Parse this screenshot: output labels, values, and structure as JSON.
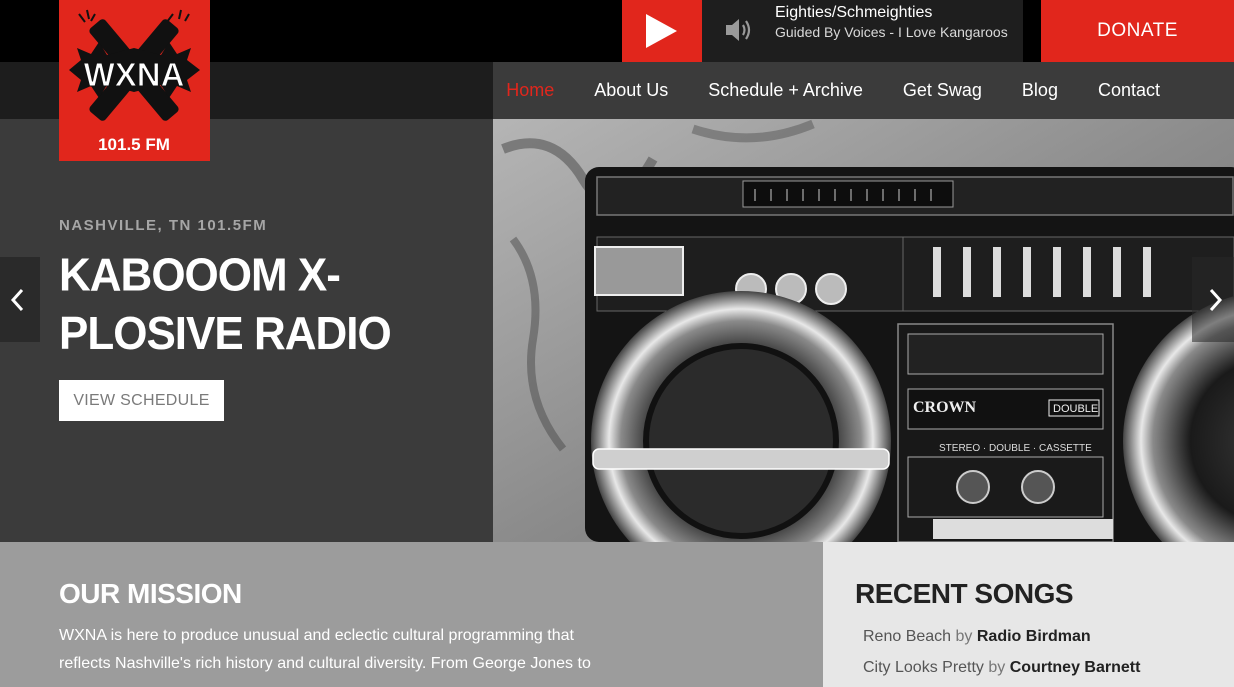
{
  "logo": {
    "name": "WXNA",
    "frequency": "101.5 FM"
  },
  "player": {
    "track_title": "Eighties/Schmeighties",
    "track_subtitle": "Guided By Voices - I Love Kangaroos"
  },
  "donate_label": "DONATE",
  "nav": {
    "items": [
      {
        "label": "Home"
      },
      {
        "label": "About Us"
      },
      {
        "label": "Schedule + Archive"
      },
      {
        "label": "Get Swag"
      },
      {
        "label": "Blog"
      },
      {
        "label": "Contact"
      }
    ]
  },
  "hero": {
    "kicker": "NASHVILLE, TN 101.5FM",
    "headline": "KABOOOM X-PLOSIVE RADIO",
    "button_label": "VIEW SCHEDULE",
    "boombox_brand": "CROWN",
    "boombox_badge": "DOUBLE",
    "boombox_caption": "STEREO · DOUBLE · CASSETTE"
  },
  "mission": {
    "title": "OUR MISSION",
    "text": "WXNA is here to produce unusual and eclectic cultural programming that reflects Nashville's rich history and cultural diversity. From George Jones to"
  },
  "recent": {
    "title": "RECENT SONGS",
    "by_word": "by",
    "songs": [
      {
        "song": "Reno Beach",
        "artist": "Radio Birdman"
      },
      {
        "song": "City Looks Pretty",
        "artist": "Courtney Barnett"
      }
    ]
  },
  "colors": {
    "accent": "#e1261c",
    "dark": "#3b3b3b",
    "black": "#000000"
  }
}
